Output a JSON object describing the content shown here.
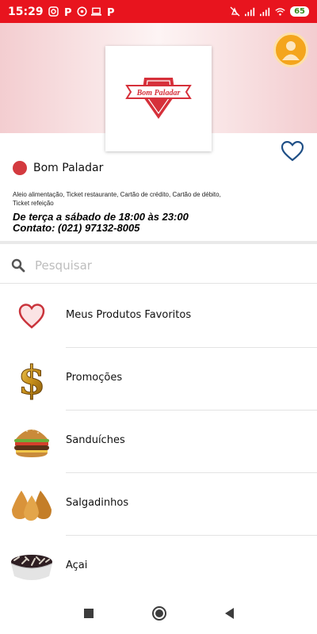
{
  "status_bar": {
    "time": "15:29",
    "left_icons": [
      "instagram-icon",
      "p-app-icon",
      "whatsapp-icon",
      "laptop-icon",
      "p-app-icon"
    ],
    "right_icons": [
      "mute-icon",
      "signal-icon",
      "signal-icon",
      "wifi-icon"
    ],
    "battery": "65"
  },
  "colors": {
    "accent": "#e8141e",
    "store_dot": "#d33a3f",
    "avatar": "#f4a51c",
    "heart": "#1f4f86"
  },
  "store": {
    "logo_text": "Bom Paladar",
    "name": "Bom Paladar",
    "payments": "Aleio alimentação, Ticket restaurante, Cartão de crédito, Cartão de débito, Ticket refeição",
    "hours": "De terça a sábado de 18:00 às 23:00",
    "contact": "Contato: (021) 97132-8005"
  },
  "search": {
    "placeholder": "Pesquisar",
    "value": ""
  },
  "categories": [
    {
      "label": "Meus Produtos Favoritos",
      "icon": "heart-icon"
    },
    {
      "label": "Promoções",
      "icon": "dollar-icon"
    },
    {
      "label": "Sanduíches",
      "icon": "burger-icon"
    },
    {
      "label": "Salgadinhos",
      "icon": "coxinha-icon"
    },
    {
      "label": "Açai",
      "icon": "acai-bowl-icon"
    }
  ],
  "nav_bar": [
    "recents-button",
    "home-button",
    "back-button"
  ]
}
